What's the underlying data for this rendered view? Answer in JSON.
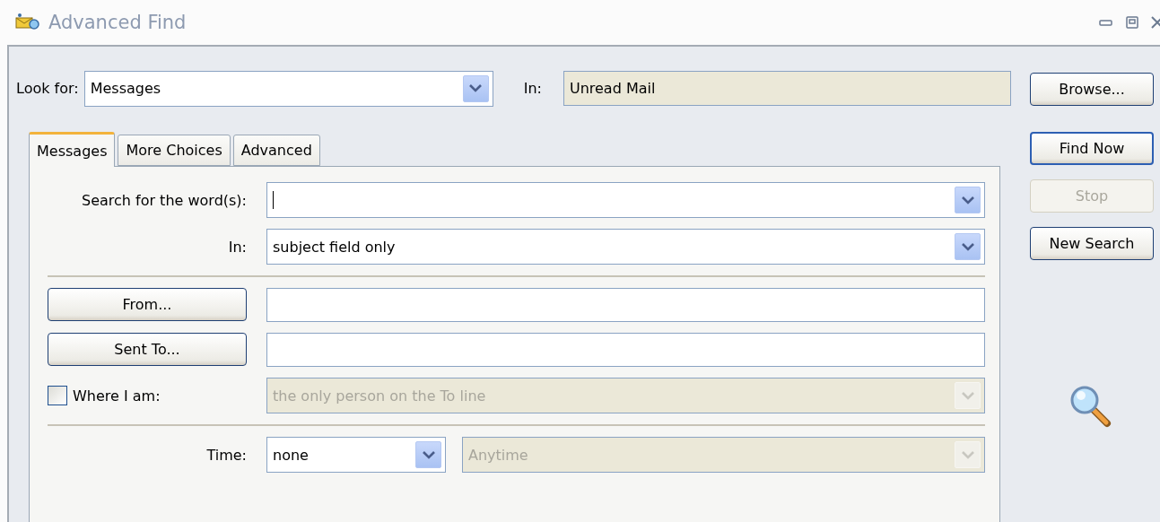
{
  "window": {
    "title": "Advanced Find"
  },
  "look_for": {
    "label": "Look for:",
    "value": "Messages"
  },
  "location": {
    "label": "In:",
    "value": "Unread Mail"
  },
  "tabs": [
    {
      "label": "Messages",
      "selected": true
    },
    {
      "label": "More Choices",
      "selected": false
    },
    {
      "label": "Advanced",
      "selected": false
    }
  ],
  "form": {
    "search_words": {
      "label": "Search for the word(s):",
      "focused": true
    },
    "search_in": {
      "label": "In:",
      "value": "subject field only",
      "disabled": false
    },
    "from": {
      "label": "From..."
    },
    "sent_to": {
      "label": "Sent To..."
    },
    "where_i_am": {
      "label": "Where I am:",
      "checked": false,
      "value": "the only person on the To line",
      "disabled": true
    },
    "time": {
      "label": "Time:",
      "value": "none",
      "disabled": false,
      "range": {
        "value": "Anytime",
        "disabled": true
      }
    }
  },
  "buttons": [
    {
      "label": "Browse...",
      "kind": "normal",
      "disabled": false
    },
    {
      "label": "Find Now",
      "kind": "default",
      "disabled": false
    },
    {
      "label": "Stop",
      "kind": "normal",
      "disabled": true
    },
    {
      "label": "New Search",
      "kind": "normal",
      "disabled": false
    }
  ]
}
